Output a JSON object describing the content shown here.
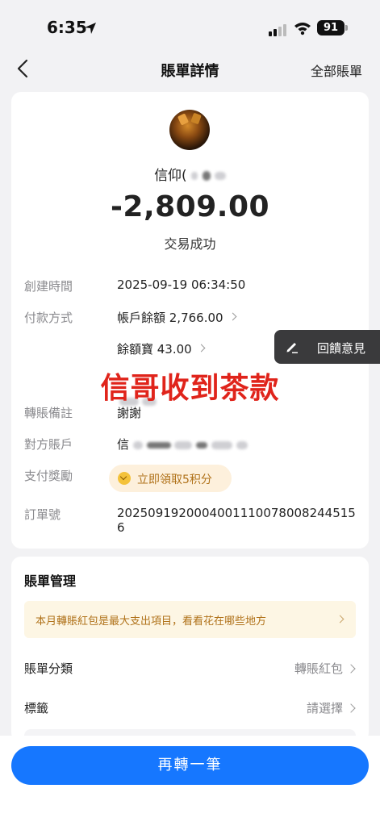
{
  "status_bar": {
    "time": "6:35",
    "battery": "91"
  },
  "nav": {
    "title": "賬單詳情",
    "right_link": "全部賬單"
  },
  "payee": {
    "name_prefix": "信仰("
  },
  "amount": "-2,809.00",
  "transaction_status": "交易成功",
  "details": {
    "created_time": {
      "label": "創建時間",
      "value": "2025-09-19 06:34:50"
    },
    "payment_method": {
      "label": "付款方式",
      "value": "帳戶餘額 2,766.00",
      "value2": "餘額寶 43.00"
    },
    "transfer_note": {
      "label": "轉賬備註",
      "value": "謝謝"
    },
    "counterparty": {
      "label": "對方賬戶",
      "value_prefix": "信"
    },
    "payment_reward": {
      "label": "支付獎勵",
      "button": "立即領取5积分"
    },
    "order_number": {
      "label": "訂單號",
      "value": "2025091920004001110078008244515​6"
    }
  },
  "feedback": {
    "label": "回饋意見"
  },
  "overlay_caption": "信哥收到茶款",
  "management": {
    "title": "賬單管理",
    "tip": "本月轉賬紅包是最大支出項目，看看花在哪些地方",
    "category": {
      "label": "賬單分類",
      "value": "轉賬紅包"
    },
    "tag": {
      "label": "標籤",
      "value": "請選擇"
    }
  },
  "cta": {
    "label": "再轉一筆"
  },
  "colors": {
    "primary": "#1677ff",
    "overlay_red": "#e0241b",
    "reward_text": "#b0721a"
  }
}
